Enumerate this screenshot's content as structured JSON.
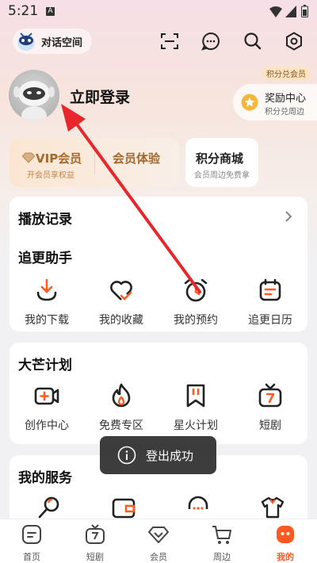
{
  "status_bar": {
    "time": "5:21",
    "notif_letter": "A"
  },
  "top_bar": {
    "chat_space_label": "对话空间"
  },
  "profile": {
    "login_label": "立即登录"
  },
  "reward": {
    "badge": "积分兑会员",
    "title": "奖励中心",
    "subtitle": "积分兑周边"
  },
  "member_cards": {
    "vip_title": "VIP会员",
    "vip_sub": "开会员享权益",
    "trial_title": "会员体验",
    "shop_title": "积分商城",
    "shop_sub": "会员周边免费拿"
  },
  "history": {
    "label": "播放记录"
  },
  "follow": {
    "title": "追更助手",
    "items": [
      {
        "label": "我的下载",
        "icon": "download-icon"
      },
      {
        "label": "我的收藏",
        "icon": "favorite-icon"
      },
      {
        "label": "我的预约",
        "icon": "alarm-icon"
      },
      {
        "label": "追更日历",
        "icon": "calendar-icon"
      }
    ]
  },
  "plan": {
    "title": "大芒计划",
    "items": [
      {
        "label": "创作中心",
        "icon": "video-add-icon"
      },
      {
        "label": "免费专区",
        "icon": "flame-icon"
      },
      {
        "label": "星火计划",
        "icon": "bookmark-icon"
      },
      {
        "label": "短剧",
        "icon": "tv-icon"
      }
    ]
  },
  "services": {
    "title": "我的服务",
    "items": [
      {
        "icon": "mic-icon"
      },
      {
        "icon": "wallet-icon"
      },
      {
        "icon": "support-icon"
      },
      {
        "icon": "shirt-icon"
      }
    ]
  },
  "toast": {
    "text": "登出成功"
  },
  "tabs": [
    {
      "label": "首页",
      "icon": "home-icon"
    },
    {
      "label": "短剧",
      "icon": "tv-icon"
    },
    {
      "label": "会员",
      "icon": "vip-icon"
    },
    {
      "label": "周边",
      "icon": "cart-icon"
    },
    {
      "label": "我的",
      "icon": "mine-icon"
    }
  ],
  "colors": {
    "accent": "#ff5a1f",
    "annotation_arrow": "#e8262c",
    "vip_gold": "#a6682a"
  }
}
